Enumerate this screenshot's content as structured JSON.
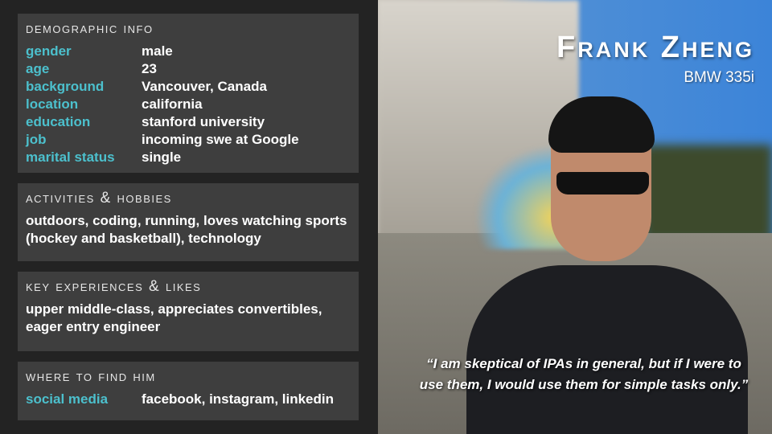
{
  "demographic": {
    "title": "Demographic Info",
    "rows": [
      {
        "key": "gender",
        "value": "male"
      },
      {
        "key": "age",
        "value": "23"
      },
      {
        "key": "background",
        "value": "Vancouver, Canada"
      },
      {
        "key": "location",
        "value": "california"
      },
      {
        "key": "education",
        "value": "stanford university"
      },
      {
        "key": "job",
        "value": "incoming swe at Google"
      },
      {
        "key": "marital status",
        "value": "single"
      }
    ]
  },
  "activities": {
    "title": "Activities & Hobbies",
    "text": "outdoors, coding, running, loves watching sports (hockey and basketball), technology"
  },
  "experiences": {
    "title": "Key Experiences & Likes",
    "text": "upper middle-class, appreciates convertibles, eager entry engineer"
  },
  "where": {
    "title": "Where to Find Him",
    "rows": [
      {
        "key": "social media",
        "value": "facebook, instagram, linkedin"
      }
    ]
  },
  "persona": {
    "name": "Frank Zheng",
    "car": "BMW 335i",
    "quote": "“I am skeptical of IPAs in general, but if I were to use them, I would use them for simple tasks only.”"
  },
  "colors": {
    "accent": "#4cc0cd",
    "panel": "#3e3e3e",
    "background": "#232323"
  }
}
